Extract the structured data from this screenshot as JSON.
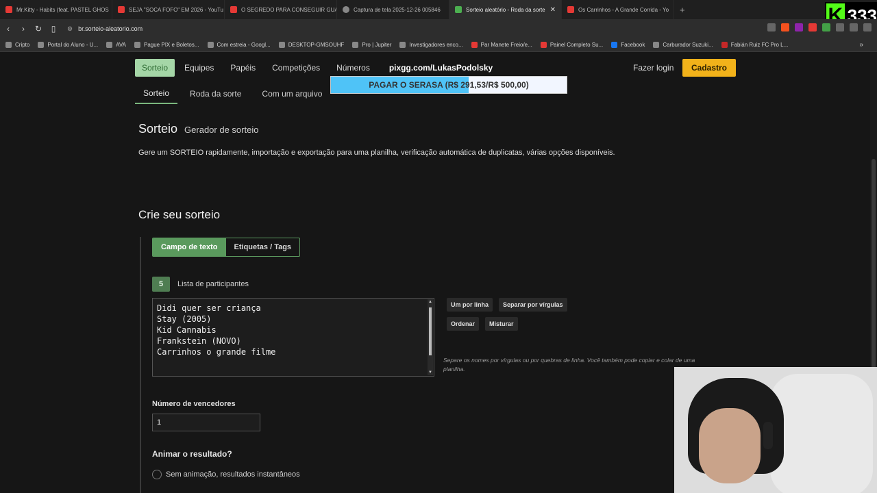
{
  "browser": {
    "tabs": [
      {
        "title": "Mr.Kitty - Habits (feat. PASTEL GHOS",
        "favicon": "youtube"
      },
      {
        "title": "SEJA \"SOCA FOFO\" EM 2026 - YouTu",
        "favicon": "youtube"
      },
      {
        "title": "O SEGREDO PARA CONSEGUIR GUA",
        "favicon": "youtube"
      },
      {
        "title": "Captura de tela 2025-12-26 005846",
        "favicon": "globe"
      },
      {
        "title": "Sorteio aleatório - Roda da sorte",
        "favicon": "site",
        "active": true
      },
      {
        "title": "Os Carrinhos - A Grande Corrida - Yo",
        "favicon": "youtube"
      }
    ],
    "url": "br.sorteio-aleatorio.com",
    "bookmarks": [
      "Cripto",
      "Portal do Aluno - U...",
      "AVA",
      "Pague PIX e Boletos...",
      "Com estreia - Googl...",
      "DESKTOP-GMSOUHF",
      "Pro | Jupiter",
      "Investigadores enco...",
      "Par Manete Freio/e...",
      "Painel Completo Su...",
      "Facebook",
      "Carburador Suzuki...",
      "Fabián Ruiz FC Pro L..."
    ]
  },
  "overlay": {
    "count": "333",
    "pix_link": "pixgg.com/LukasPodolsky",
    "serasa_text": "PAGAR O SERASA (R$ 291,53/R$ 500,00)",
    "serasa_progress": 0.583
  },
  "site": {
    "nav": [
      "Sorteio",
      "Equipes",
      "Papéis",
      "Competições",
      "Números"
    ],
    "login": "Fazer login",
    "signup": "Cadastro",
    "subnav": [
      "Sorteio",
      "Roda da sorte",
      "Com um arquivo"
    ],
    "title": "Sorteio",
    "subtitle": "Gerador de sorteio",
    "description": "Gere um SORTEIO rapidamente, importação e exportação para uma planilha, verificação automática de duplicatas, várias opções disponíveis.",
    "create_heading": "Crie seu sorteio",
    "modes": [
      "Campo de texto",
      "Etiquetas / Tags"
    ],
    "participants_count": "5",
    "participants_label": "Lista de participantes",
    "participants": [
      "Didi quer ser criança",
      "Stay (2005)",
      "Kid Cannabis",
      "Frankstein (NOVO)",
      "Carrinhos o grande filme"
    ],
    "tools": [
      "Um por linha",
      "Separar por vírgulas",
      "Ordenar",
      "Misturar"
    ],
    "hint": "Separe os nomes por vírgulas ou por quebras de linha. Você também pode copiar e colar de uma planilha.",
    "winners_label": "Número de vencedores",
    "winners_value": "1",
    "animate_label": "Animar o resultado?",
    "radio_no_anim": "Sem animação, resultados instantâneos"
  }
}
